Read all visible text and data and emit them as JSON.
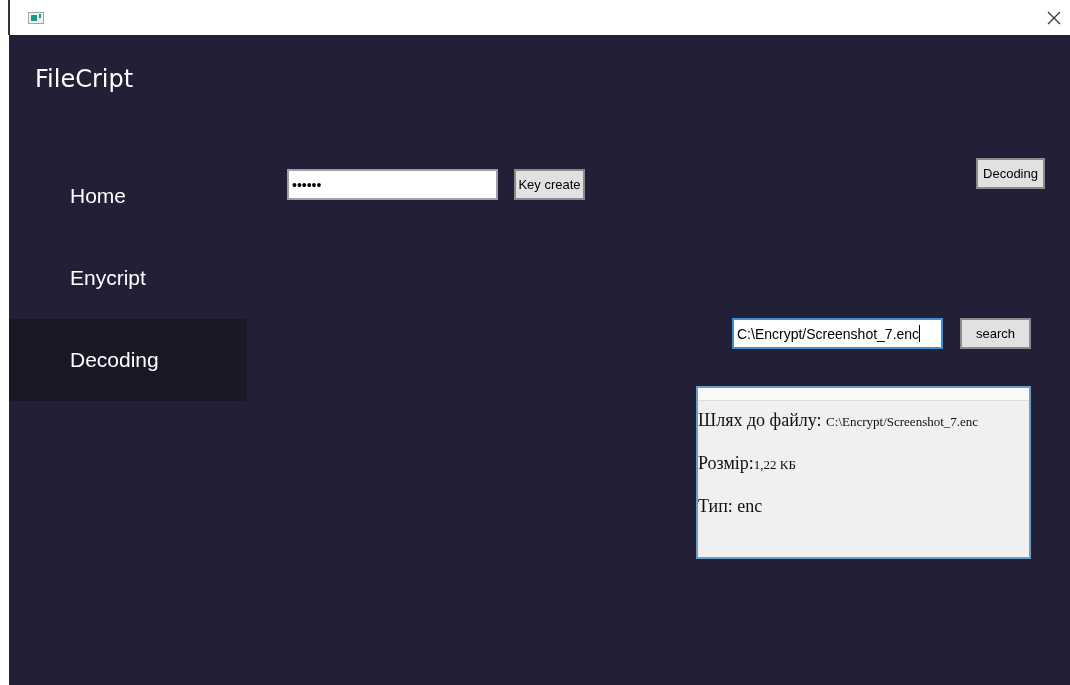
{
  "app_title": "FileCript",
  "nav": [
    {
      "label": "Home",
      "selected": false
    },
    {
      "label": "Enycript",
      "selected": false
    },
    {
      "label": "Decoding",
      "selected": true
    }
  ],
  "key_field": {
    "value": "••••••"
  },
  "key_button": "Key create",
  "decoding_button": "Decoding",
  "path_field": {
    "value": "C:\\Encrypt/Screenshot_7.enc"
  },
  "search_button": "search",
  "file_info": [
    {
      "label": "Шлях до файлу: ",
      "value": "C:\\Encrypt/Screenshot_7.enc"
    },
    {
      "label": "Розмір:",
      "value": "1,22 КБ"
    },
    {
      "label": "Тип: ",
      "value": "enc",
      "small": false
    }
  ]
}
